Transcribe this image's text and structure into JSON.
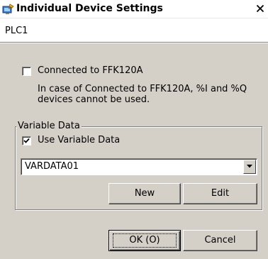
{
  "window": {
    "title": "Individual Device Settings",
    "close_label": "×"
  },
  "device": {
    "name": "PLC1"
  },
  "ffk": {
    "checkbox_label": "Connected to FFK120A",
    "checked": false,
    "note_line1": "In case of Connected to FFK120A, %I and %Q",
    "note_line2": "devices cannot be used."
  },
  "variable_data": {
    "group_label": "Variable Data",
    "use_label": "Use Variable Data",
    "use_checked": true,
    "selected": "VARDATA01",
    "new_label": "New",
    "edit_label": "Edit"
  },
  "dialog": {
    "ok_label": "OK (O)",
    "cancel_label": "Cancel"
  }
}
